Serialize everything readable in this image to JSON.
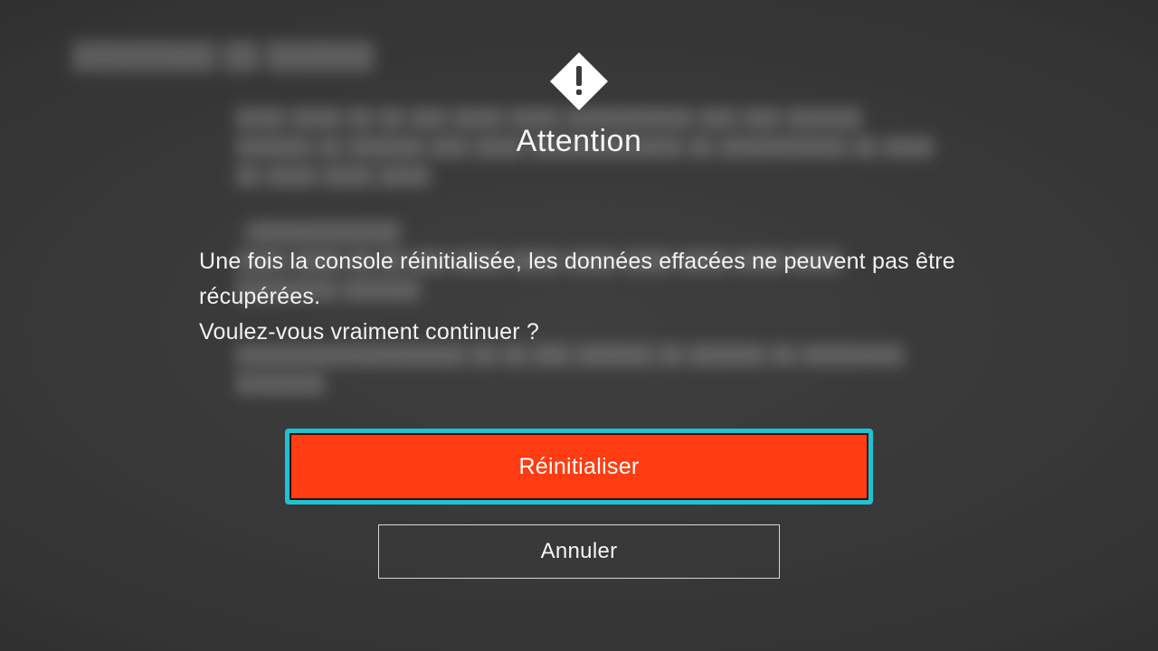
{
  "dialog": {
    "title": "Attention",
    "message_line1": "Une fois la console réinitialisée, les données effacées ne peuvent pas être récupérées.",
    "message_line2": "Voulez-vous vraiment continuer ?",
    "primary_label": "Réinitialiser",
    "secondary_label": "Annuler"
  },
  "colors": {
    "accent_focus": "#1fc2d1",
    "danger": "#ff3c12",
    "text": "#f5f5f5"
  }
}
